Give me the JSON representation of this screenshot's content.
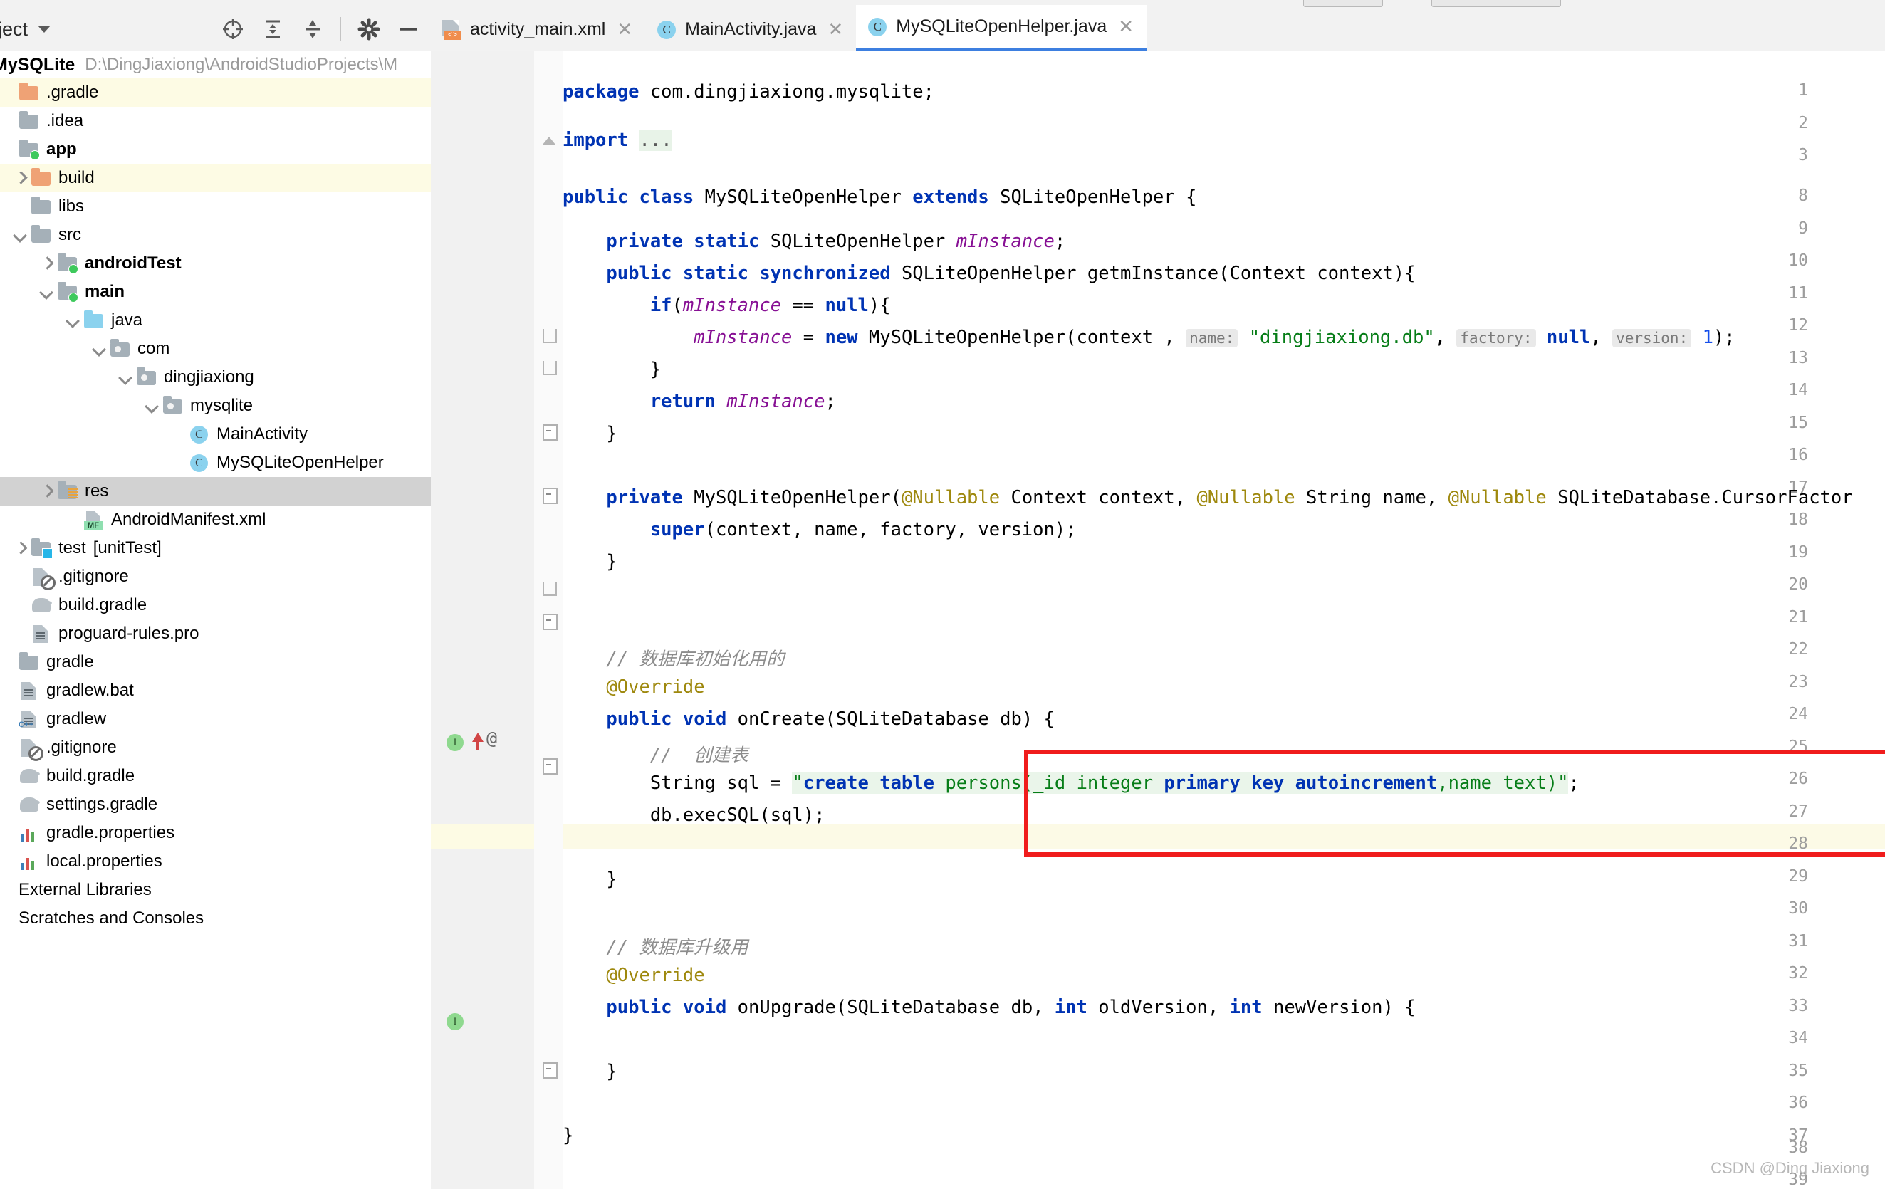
{
  "window": {
    "project_panel_title": "oject",
    "module_name": "MySQLite",
    "module_path": "D:\\DingJiaxiong\\AndroidStudioProjects\\M"
  },
  "toolbar": {
    "icons": [
      {
        "name": "locate-icon",
        "glyph": "⊕"
      },
      {
        "name": "expand-all-icon",
        "glyph": "⇲"
      },
      {
        "name": "collapse-all-icon",
        "glyph": "⇱"
      },
      {
        "name": "settings-gear-icon",
        "glyph": "⚙"
      },
      {
        "name": "hide-panel-icon",
        "glyph": "—"
      }
    ]
  },
  "tree": [
    {
      "label": ".gradle",
      "indent": 0,
      "arrow": "none",
      "icon": "folder-orange",
      "highlight": "yellow",
      "bold": false
    },
    {
      "label": ".idea",
      "indent": 0,
      "arrow": "none",
      "icon": "folder-gray",
      "highlight": "none",
      "bold": false
    },
    {
      "label": "app",
      "indent": 0,
      "arrow": "none",
      "icon": "folder-module",
      "highlight": "none",
      "bold": true
    },
    {
      "label": "build",
      "indent": 1,
      "arrow": "right",
      "icon": "folder-orange",
      "highlight": "yellow",
      "bold": false
    },
    {
      "label": "libs",
      "indent": 1,
      "arrow": "none",
      "icon": "folder-gray",
      "highlight": "none",
      "bold": false
    },
    {
      "label": "src",
      "indent": 1,
      "arrow": "down",
      "icon": "folder-gray",
      "highlight": "none",
      "bold": false
    },
    {
      "label": "androidTest",
      "indent": 2,
      "arrow": "right",
      "icon": "folder-module",
      "highlight": "none",
      "bold": true
    },
    {
      "label": "main",
      "indent": 2,
      "arrow": "down",
      "icon": "folder-module",
      "highlight": "none",
      "bold": true
    },
    {
      "label": "java",
      "indent": 3,
      "arrow": "down",
      "icon": "folder-blue",
      "highlight": "none",
      "bold": false
    },
    {
      "label": "com",
      "indent": 4,
      "arrow": "down",
      "icon": "folder-package",
      "highlight": "none",
      "bold": false
    },
    {
      "label": "dingjiaxiong",
      "indent": 5,
      "arrow": "down",
      "icon": "folder-package",
      "highlight": "none",
      "bold": false
    },
    {
      "label": "mysqlite",
      "indent": 6,
      "arrow": "down",
      "icon": "folder-package",
      "highlight": "none",
      "bold": false
    },
    {
      "label": "MainActivity",
      "indent": 7,
      "arrow": "none",
      "icon": "java-class",
      "highlight": "none",
      "bold": false
    },
    {
      "label": "MySQLiteOpenHelper",
      "indent": 7,
      "arrow": "none",
      "icon": "java-class",
      "highlight": "none",
      "bold": false
    },
    {
      "label": "res",
      "indent": 2,
      "arrow": "right",
      "icon": "folder-res",
      "highlight": "gray",
      "bold": false
    },
    {
      "label": "AndroidManifest.xml",
      "indent": 3,
      "arrow": "none",
      "icon": "manifest",
      "highlight": "none",
      "bold": false
    },
    {
      "label": "test",
      "suffix": "[unitTest]",
      "indent": 1,
      "arrow": "right",
      "icon": "folder-test",
      "highlight": "none",
      "bold": false
    },
    {
      "label": ".gitignore",
      "indent": 1,
      "arrow": "none",
      "icon": "gitignore",
      "highlight": "none",
      "bold": false
    },
    {
      "label": "build.gradle",
      "indent": 1,
      "arrow": "none",
      "icon": "gradle",
      "highlight": "none",
      "bold": false
    },
    {
      "label": "proguard-rules.pro",
      "indent": 1,
      "arrow": "none",
      "icon": "file",
      "highlight": "none",
      "bold": false
    },
    {
      "label": "gradle",
      "indent": 0,
      "arrow": "none",
      "icon": "folder-gray",
      "highlight": "none",
      "bold": false
    },
    {
      "label": "gradlew.bat",
      "indent": 0,
      "arrow": "none",
      "icon": "file",
      "highlight": "none",
      "bold": false
    },
    {
      "label": "gradlew",
      "indent": 0,
      "arrow": "none",
      "icon": "cpp-file",
      "highlight": "none",
      "bold": false
    },
    {
      "label": ".gitignore",
      "indent": 0,
      "arrow": "none",
      "icon": "gitignore",
      "highlight": "none",
      "bold": false
    },
    {
      "label": "build.gradle",
      "indent": 0,
      "arrow": "none",
      "icon": "gradle",
      "highlight": "none",
      "bold": false
    },
    {
      "label": "settings.gradle",
      "indent": 0,
      "arrow": "none",
      "icon": "gradle",
      "highlight": "none",
      "bold": false
    },
    {
      "label": "gradle.properties",
      "indent": 0,
      "arrow": "none",
      "icon": "properties",
      "highlight": "none",
      "bold": false
    },
    {
      "label": "local.properties",
      "indent": 0,
      "arrow": "none",
      "icon": "properties",
      "highlight": "none",
      "bold": false
    },
    {
      "label": "External Libraries",
      "indent": -1,
      "arrow": "none",
      "icon": "none",
      "highlight": "none",
      "bold": false
    },
    {
      "label": "Scratches and Consoles",
      "indent": -1,
      "arrow": "none",
      "icon": "none",
      "highlight": "none",
      "bold": false
    }
  ],
  "tabs": [
    {
      "label": "activity_main.xml",
      "icon": "xml-layout-icon",
      "active": false
    },
    {
      "label": "MainActivity.java",
      "icon": "java-class-icon",
      "active": false
    },
    {
      "label": "MySQLiteOpenHelper.java",
      "icon": "java-class-icon",
      "active": true
    }
  ],
  "editor": {
    "current_line": 28,
    "line_numbers": [
      1,
      2,
      3,
      8,
      9,
      10,
      11,
      12,
      13,
      14,
      15,
      16,
      17,
      18,
      19,
      20,
      21,
      22,
      23,
      24,
      25,
      26,
      27,
      28,
      29,
      30,
      31,
      32,
      33,
      34,
      35,
      36,
      37,
      38,
      39
    ],
    "code": {
      "l1": "package com.dingjiaxiong.mysqlite;",
      "l3_kw": "import",
      "l3_dots": "...",
      "l9": "public class MySQLiteOpenHelper extends SQLiteOpenHelper {",
      "l11": "private static SQLiteOpenHelper mInstance;",
      "l12": "public static synchronized SQLiteOpenHelper getmInstance(Context context){",
      "l13": "if(mInstance == null){",
      "l14_a": "mInstance = new MySQLiteOpenHelper(context ,",
      "l14_hint1": "name:",
      "l14_str": "\"dingjiaxiong.db\"",
      "l14_hint2": "factory:",
      "l14_null": "null",
      "l14_hint3": "version:",
      "l14_num": "1",
      "l14_end": ");",
      "l15": "}",
      "l16": "return mInstance;",
      "l17": "}",
      "l19": "private MySQLiteOpenHelper(@Nullable Context context, @Nullable String name, @Nullable SQLiteDatabase.CursorFactor",
      "l20": "super(context, name, factory, version);",
      "l21": "}",
      "l23": "// 数据库初始化用的",
      "l24": "@Override",
      "l25": "public void onCreate(SQLiteDatabase db) {",
      "l26": "// 创建表",
      "l27_a": "String sql = ",
      "l27_str": "\"create table persons(_id integer primary key autoincrement,name text)\"",
      "l27_end": ";",
      "l28": "db.execSQL(sql);",
      "l30": "}",
      "l32": "// 数据库升级用",
      "l33": "@Override",
      "l34": "public void onUpgrade(SQLiteDatabase db, int oldVersion, int newVersion) {",
      "l36": "}",
      "l38": "}"
    },
    "gutter_markers": {
      "line25_impl": "I",
      "line25_at": "@",
      "line34_impl": "I"
    }
  },
  "annotation": {
    "name": "red-highlight-box",
    "color": "#f01c1c"
  },
  "watermark": "CSDN @Ding Jiaxiong"
}
